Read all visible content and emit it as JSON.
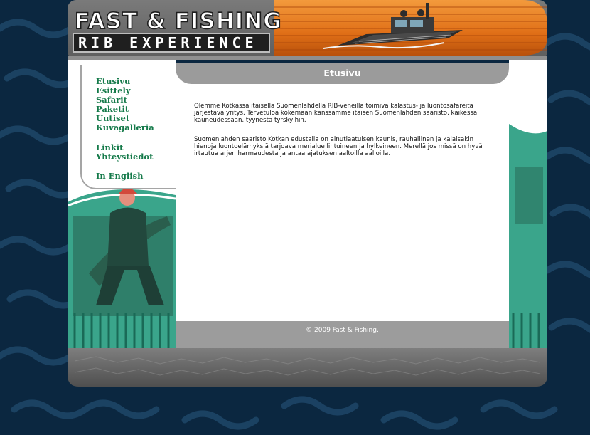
{
  "header": {
    "logo_line1": "FAST & FISHING",
    "logo_line2": "RIB EXPERIENCE"
  },
  "nav": {
    "items": [
      {
        "label": "Etusivu"
      },
      {
        "label": "Esittely"
      },
      {
        "label": "Safarit"
      },
      {
        "label": "Paketit"
      },
      {
        "label": "Uutiset"
      },
      {
        "label": "Kuvagalleria"
      },
      {
        "label": "Linkit"
      },
      {
        "label": "Yhteystiedot"
      },
      {
        "label": "In English"
      }
    ]
  },
  "main": {
    "title": "Etusivu",
    "paragraphs": [
      "Olemme Kotkassa itäisellä Suomenlahdella RIB-veneillä toimiva kalastus- ja luontosafareita järjestävä yritys. Tervetuloa kokemaan kanssamme itäisen Suomenlahden saaristo, kaikessa kauneudessaan, tyynestä tyrskyihin.",
      "Suomenlahden saaristo Kotkan edustalla on ainutlaatuisen kaunis, rauhallinen ja kalaisakin hienoja luontoelämyksiä tarjoava merialue lintuineen ja hylkeineen. Merellä jos missä on hyvä irtautua arjen harmaudesta ja antaa ajatuksen aaltoilla aalloilla."
    ]
  },
  "footer": {
    "copyright": "© 2009 Fast & Fishing."
  },
  "colors": {
    "page_background": "#0b2740",
    "header_orange": "#e87a1e",
    "nav_link": "#157a4a",
    "panel_gray": "#9b9b9b",
    "teal": "#2aa98a"
  },
  "icons": {
    "boat": "boat-illustration",
    "angler": "angler-with-pike-photo"
  }
}
